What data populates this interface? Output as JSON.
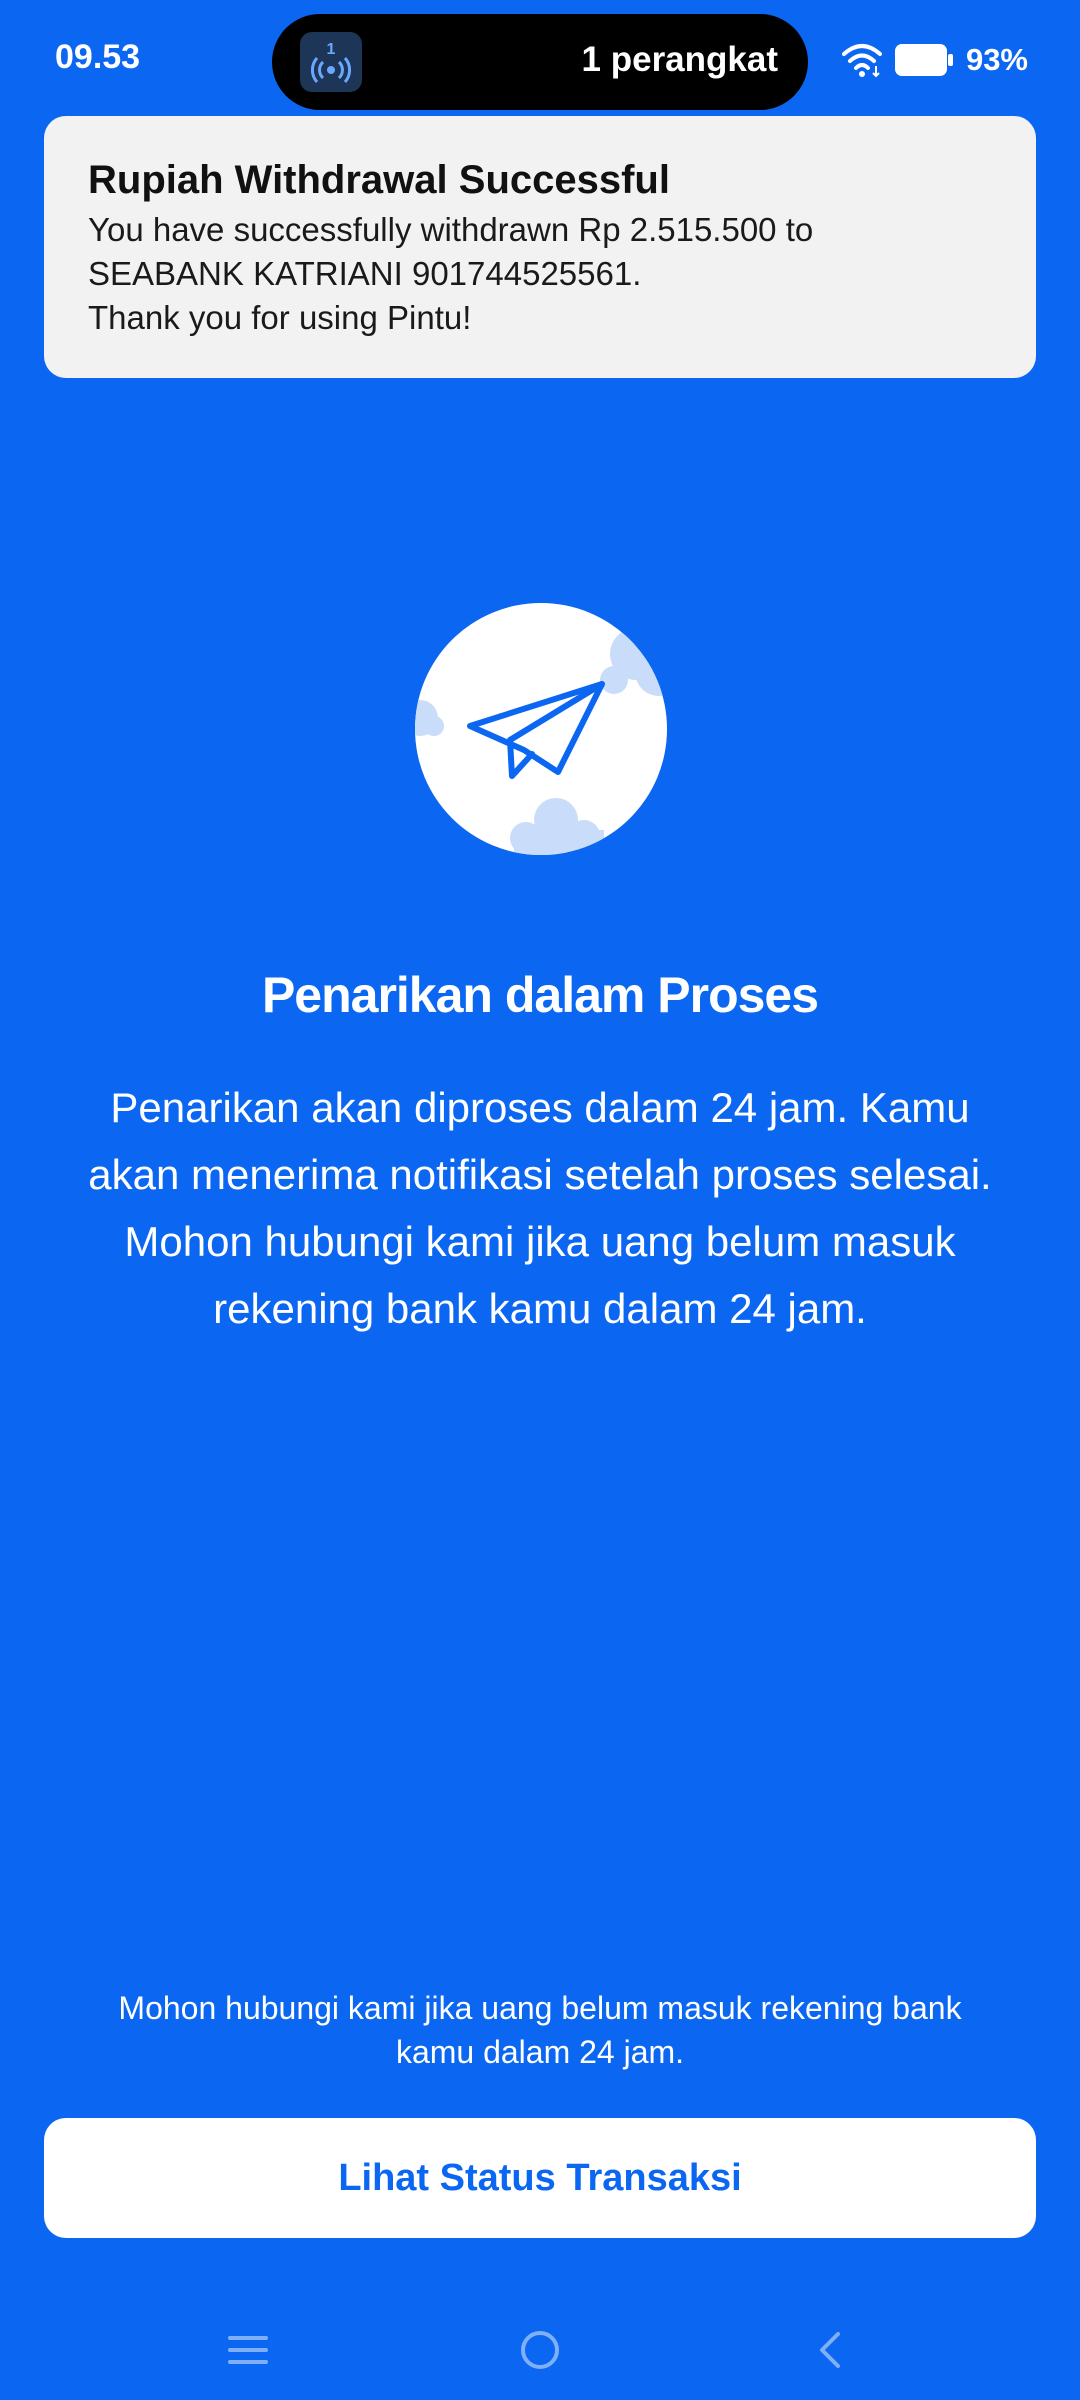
{
  "status_bar": {
    "time": "09.53",
    "island_badge": "1",
    "island_text": "1 perangkat",
    "battery": "93%"
  },
  "notification": {
    "title": "Rupiah Withdrawal Successful",
    "lines": [
      "You have successfully withdrawn Rp 2.515.500 to",
      "SEABANK KATRIANI 901744525561.",
      "Thank you for using Pintu!"
    ]
  },
  "main": {
    "illustration_icon": "paper-plane-icon",
    "title": "Penarikan dalam Proses",
    "description": "Penarikan akan diproses dalam 24 jam. Kamu akan menerima notifikasi setelah proses selesai. Mohon hubungi kami jika uang belum masuk rekening bank kamu dalam 24 jam."
  },
  "footer": {
    "note": "Mohon hubungi kami jika uang belum masuk rekening bank kamu dalam 24 jam.",
    "button_label": "Lihat Status Transaksi"
  },
  "nav": {
    "icons": [
      "menu-icon",
      "home-icon",
      "back-icon"
    ]
  },
  "colors": {
    "background": "#0B67F2",
    "notification_bg": "#F2F2F2",
    "button_bg": "#FFFFFF",
    "button_text": "#0B67F2"
  }
}
